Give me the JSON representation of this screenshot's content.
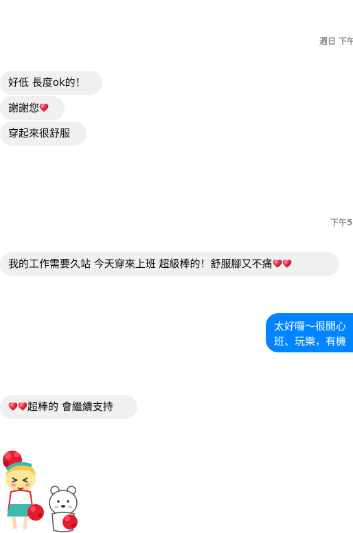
{
  "timestamps": {
    "t1": "週日 下午",
    "t2": "下午5"
  },
  "messages": {
    "m1": "好低 長度ok的！",
    "m2": "謝謝您",
    "m3": "穿起來很舒服",
    "m4": "我的工作需要久站 今天穿來上班 超級棒的！舒服腳又不痛",
    "m5_line1": "太好囉～很開心",
    "m5_line2": "班、玩樂，有機",
    "m6": "超棒的 會繼續支持"
  },
  "icons": {
    "heart": "red-heart-emoji",
    "sticker": "cheerleader-girl-and-bear-sticker"
  },
  "colors": {
    "incoming_bubble": "#f0f0f0",
    "outgoing_bubble": "#0084ff",
    "timestamp": "#8a8d91",
    "heart": "#e0243a"
  }
}
